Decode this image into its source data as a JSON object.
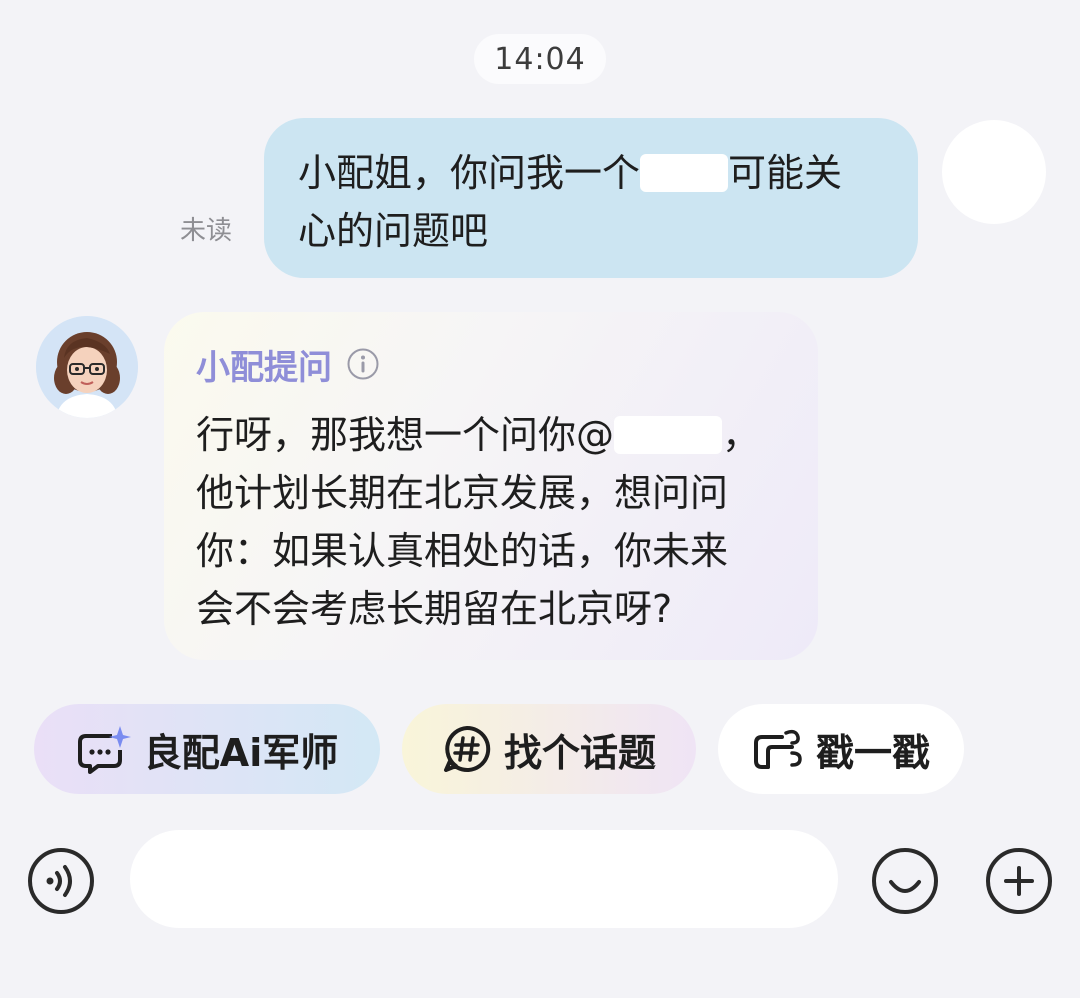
{
  "timestamp": "14:04",
  "my_message": {
    "status": "未读",
    "line1_before": "小配姐，你问我一个",
    "line1_after": "可能关",
    "line2": "心的问题吧"
  },
  "bot_message": {
    "title": "小配提问",
    "line1": "行呀，那我想一个问你@",
    "line1_end": "，",
    "line2": "他计划长期在北京发展，想问问",
    "line3": "你：如果认真相处的话，你未来",
    "line4": "会不会考虑长期留在北京呀?"
  },
  "actions": [
    {
      "label": "良配Ai军师",
      "icon": "ai-chat-sparkle-icon"
    },
    {
      "label": "找个话题",
      "icon": "hashtag-bubble-icon"
    },
    {
      "label": "戳一戳",
      "icon": "poke-icon"
    }
  ],
  "input": {
    "placeholder": "",
    "value": ""
  },
  "icons": {
    "voice": "voice-icon",
    "emoji": "emoji-icon",
    "plus": "plus-icon",
    "info": "info-icon"
  },
  "colors": {
    "background": "#f3f3f7",
    "my_bubble": "#cce5f2",
    "bot_title": "#8f8ed8"
  }
}
